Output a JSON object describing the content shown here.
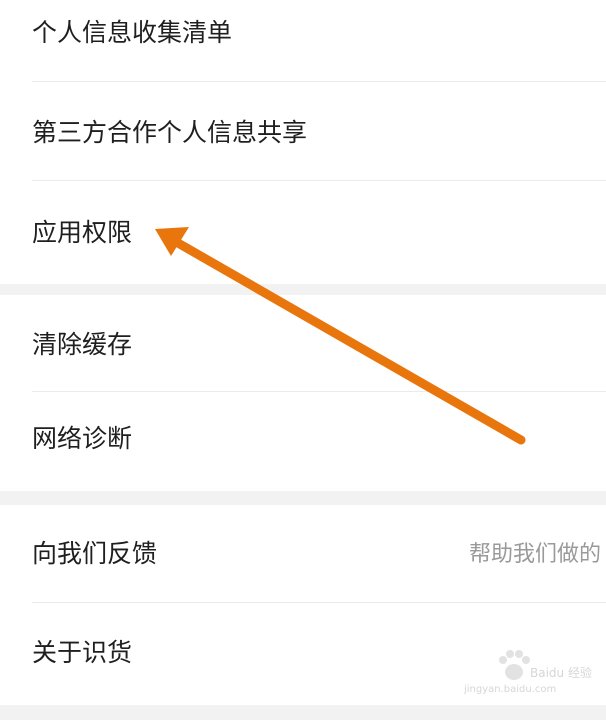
{
  "settings": {
    "items": [
      {
        "label": "个人信息收集清单"
      },
      {
        "label": "第三方合作个人信息共享"
      },
      {
        "label": "应用权限"
      },
      {
        "label": "清除缓存"
      },
      {
        "label": "网络诊断"
      },
      {
        "label": "向我们反馈",
        "hint": "帮助我们做的"
      },
      {
        "label": "关于识货"
      }
    ]
  },
  "annotation": {
    "arrow_color": "#e8760c",
    "points_to": "应用权限"
  },
  "watermark": {
    "text": "Baidu 经验",
    "subtext": "jingyan.baidu.com"
  }
}
